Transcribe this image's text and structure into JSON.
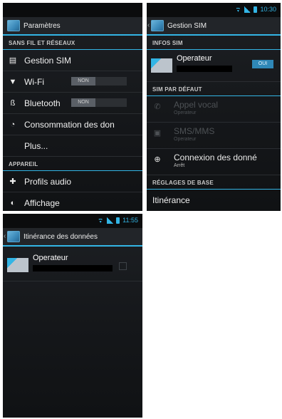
{
  "screen1": {
    "action_bar": {
      "title": "Paramètres",
      "icon": "settings-app-icon"
    },
    "section_network": "SANS FIL ET RÉSEAUX",
    "items": [
      {
        "label": "Gestion SIM",
        "icon": "sim-card-icon"
      },
      {
        "label": "Wi-Fi",
        "icon": "wifi-icon",
        "toggle": "NON"
      },
      {
        "label": "Bluetooth",
        "icon": "bluetooth-icon",
        "toggle": "NON"
      },
      {
        "label": "Consommation des don",
        "icon": "data-usage-icon"
      },
      {
        "label": "Plus..."
      }
    ],
    "section_device": "APPAREIL",
    "device_items": [
      {
        "label": "Profils audio",
        "icon": "audio-profiles-icon"
      },
      {
        "label": "Affichage",
        "icon": "display-icon"
      }
    ]
  },
  "screen2": {
    "status_time": "10:30",
    "action_bar": {
      "title": "Gestion SIM"
    },
    "section_sim_info": "INFOS SIM",
    "sim_name": "Operateur",
    "sim_toggle": "OUI",
    "section_default": "SIM PAR DÉFAUT",
    "default_items": [
      {
        "title": "Appel vocal",
        "subtitle": "Operateur",
        "icon": "phone-icon",
        "enabled": false
      },
      {
        "title": "SMS/MMS",
        "subtitle": "Operateur",
        "icon": "message-icon",
        "enabled": false
      },
      {
        "title": "Connexion des donné",
        "subtitle": "Arrêt",
        "icon": "globe-icon",
        "enabled": true
      }
    ],
    "section_basic": "RÉGLAGES DE BASE",
    "basic_item": "Itinérance"
  },
  "screen3": {
    "status_time": "11:55",
    "action_bar": {
      "title": "Itinérance des données"
    },
    "sim_name": "Operateur"
  },
  "colors": {
    "accent": "#33b5e5",
    "background": "#16181b"
  }
}
